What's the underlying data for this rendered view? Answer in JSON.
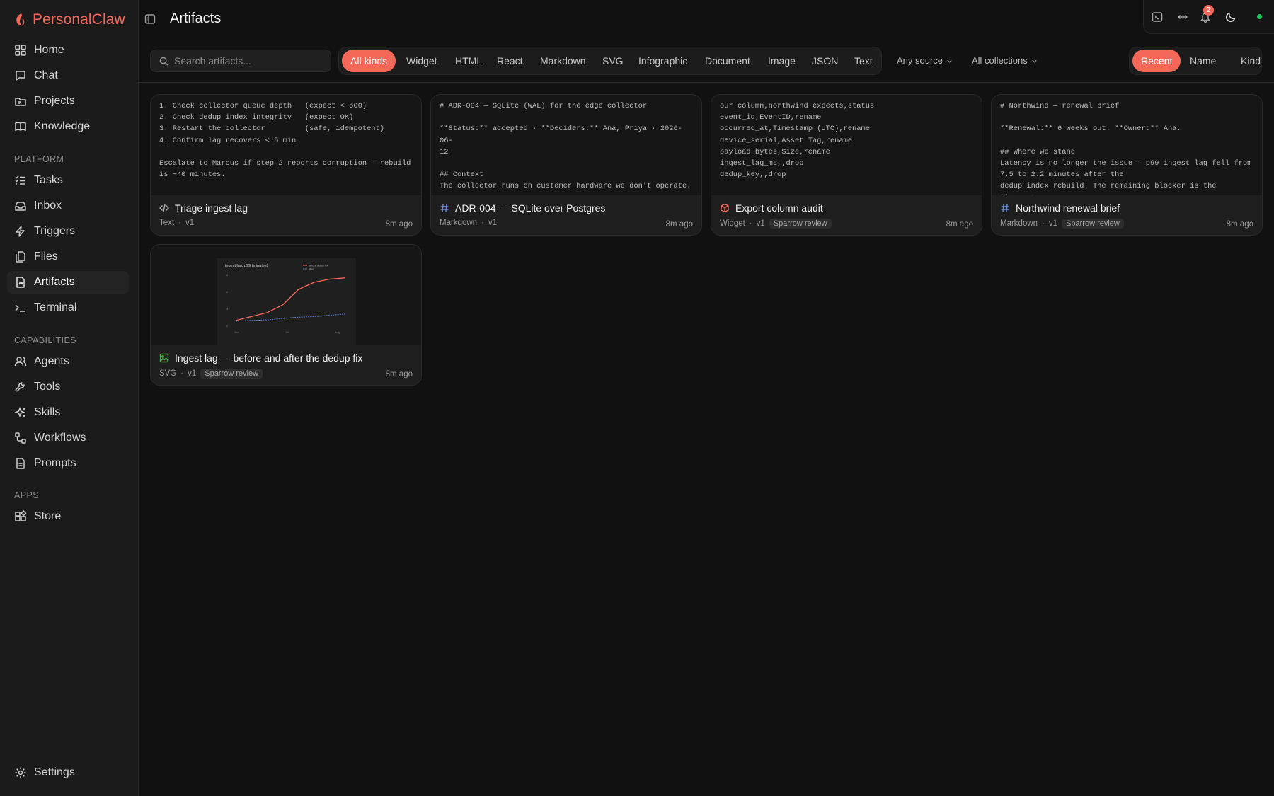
{
  "app": {
    "name": "PersonalClaw"
  },
  "sidebar": {
    "main": [
      {
        "label": "Home",
        "icon": "grid-icon"
      },
      {
        "label": "Chat",
        "icon": "chat-bubble-icon"
      },
      {
        "label": "Projects",
        "icon": "folder-icon"
      },
      {
        "label": "Knowledge",
        "icon": "book-icon"
      }
    ],
    "platform_label": "PLATFORM",
    "platform": [
      {
        "label": "Tasks",
        "icon": "checklist-icon"
      },
      {
        "label": "Inbox",
        "icon": "inbox-icon"
      },
      {
        "label": "Triggers",
        "icon": "bolt-icon"
      },
      {
        "label": "Files",
        "icon": "files-icon"
      },
      {
        "label": "Artifacts",
        "icon": "artifact-icon",
        "active": true
      },
      {
        "label": "Terminal",
        "icon": "terminal-icon"
      }
    ],
    "capabilities_label": "CAPABILITIES",
    "capabilities": [
      {
        "label": "Agents",
        "icon": "users-icon"
      },
      {
        "label": "Tools",
        "icon": "wrench-icon"
      },
      {
        "label": "Skills",
        "icon": "sparkles-icon"
      },
      {
        "label": "Workflows",
        "icon": "workflow-icon"
      },
      {
        "label": "Prompts",
        "icon": "document-icon"
      }
    ],
    "apps_label": "APPS",
    "apps": [
      {
        "label": "Store",
        "icon": "store-icon"
      }
    ],
    "settings_label": "Settings"
  },
  "header": {
    "title": "Artifacts",
    "notification_count": "2"
  },
  "toolbar": {
    "search_placeholder": "Search artifacts...",
    "kinds": [
      "All kinds",
      "Widget",
      "HTML",
      "React",
      "Markdown",
      "SVG",
      "Infographic",
      "Document",
      "Image",
      "JSON",
      "Text"
    ],
    "active_kind": "All kinds",
    "source_filter": "Any source",
    "collection_filter": "All collections",
    "sort_options": [
      "Recent",
      "Name",
      "Kind"
    ],
    "active_sort": "Recent"
  },
  "artifacts": [
    {
      "title": "Triage ingest lag",
      "kind": "Text",
      "version": "v1",
      "tag": "",
      "time": "8m ago",
      "icon": "code-icon",
      "preview": "1. Check collector queue depth   (expect < 500)\n2. Check dedup index integrity   (expect OK)\n3. Restart the collector         (safe, idempotent)\n4. Confirm lag recovers < 5 min\n\nEscalate to Marcus if step 2 reports corruption — rebuild\nis ~40 minutes."
    },
    {
      "title": "ADR-004 — SQLite over Postgres",
      "kind": "Markdown",
      "version": "v1",
      "tag": "",
      "time": "8m ago",
      "icon": "hash-icon",
      "preview": "# ADR-004 — SQLite (WAL) for the edge collector\n\n**Status:** accepted · **Deciders:** Ana, Priya · 2026-06-\n12\n\n## Context\nThe collector runs on customer hardware we don't operate.\n\n## Decision"
    },
    {
      "title": "Export column audit",
      "kind": "Widget",
      "version": "v1",
      "tag": "Sparrow review",
      "time": "8m ago",
      "icon": "cube-icon",
      "preview": "our_column,northwind_expects,status\nevent_id,EventID,rename\noccurred_at,Timestamp (UTC),rename\ndevice_serial,Asset Tag,rename\npayload_bytes,Size,rename\ningest_lag_ms,,drop\ndedup_key,,drop"
    },
    {
      "title": "Northwind renewal brief",
      "kind": "Markdown",
      "version": "v1",
      "tag": "Sparrow review",
      "time": "8m ago",
      "icon": "hash-icon",
      "preview": "# Northwind — renewal brief\n\n**Renewal:** 6 weeks out. **Owner:** Ana.\n\n## Where we stand\nLatency is no longer the issue — p99 ingest lag fell from\n7.5 to 2.2 minutes after the\ndedup index rebuild. The remaining blocker is the **export\nformat**."
    },
    {
      "title": "Ingest lag — before and after the dedup fix",
      "kind": "SVG",
      "version": "v1",
      "tag": "Sparrow review",
      "time": "8m ago",
      "icon": "image-icon",
      "preview": ""
    }
  ],
  "svg_thumbnail": {
    "title": "Ingest lag, p99 (minutes)",
    "legend": [
      "before dedup fix",
      "after"
    ],
    "x_labels": [
      "Jun",
      "Jul",
      "Aug"
    ],
    "y_labels": [
      "8",
      "6",
      "4",
      "2"
    ],
    "before": [
      1.0,
      1.6,
      2.2,
      3.4,
      5.8,
      6.9,
      7.4,
      7.6
    ],
    "after": [
      0.9,
      1.0,
      1.1,
      1.3,
      1.5,
      1.6,
      1.8,
      2.0
    ],
    "colors": {
      "before": "#f4685a",
      "after": "#5b7bd5"
    }
  },
  "colors": {
    "accent": "#f4685a",
    "status_online": "#22c55e"
  }
}
